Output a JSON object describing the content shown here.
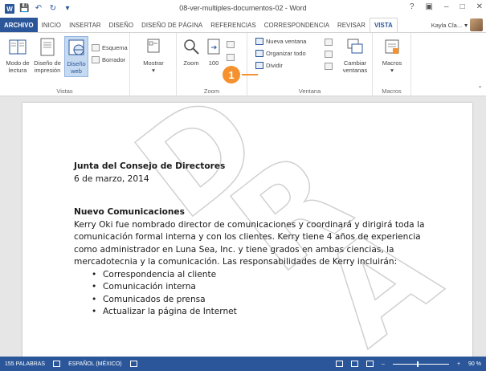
{
  "window": {
    "title": "08-ver-multiples-documentos-02 - Word",
    "controls": [
      "?",
      "▣",
      "–",
      "□",
      "✕"
    ]
  },
  "tabs": [
    {
      "label": "ARCHIVO",
      "kind": "file"
    },
    {
      "label": "INICIO"
    },
    {
      "label": "INSERTAR"
    },
    {
      "label": "DISEÑO"
    },
    {
      "label": "DISEÑO DE PÁGINA"
    },
    {
      "label": "REFERENCIAS"
    },
    {
      "label": "CORRESPONDENCIA"
    },
    {
      "label": "REVISAR"
    },
    {
      "label": "VISTA",
      "kind": "active"
    }
  ],
  "user": {
    "name": "Kayla Cla..."
  },
  "ribbon": {
    "vistas": {
      "label": "Vistas",
      "modo_lectura": "Modo de\nlectura",
      "diseno_impresion": "Diseño de\nimpresión",
      "diseno_web": "Diseño\nweb",
      "esquema": "Esquema",
      "borrador": "Borrador"
    },
    "mostrar": {
      "label": "Mostrar"
    },
    "zoom": {
      "label": "Zoom",
      "zoom_btn": "Zoom",
      "percent": "100"
    },
    "ventana": {
      "label": "Ventana",
      "nueva_ventana": "Nueva ventana",
      "organizar_todo": "Organizar todo",
      "dividir": "Dividir",
      "cambiar_ventanas": "Cambiar\nventanas"
    },
    "macros": {
      "label": "Macros",
      "macros_btn": "Macros"
    }
  },
  "callout": {
    "number": "1"
  },
  "document": {
    "heading1": "Junta del Consejo de Directores",
    "date": "6 de marzo, 2014",
    "heading2": "Nuevo Comunicaciones",
    "paragraph": "Kerry Oki fue nombrado director de comunicaciones y coordinará y dirigirá toda la comunicación formal interna y con los clientes. Kerry tiene 4 años de experiencia como administrador en Luna Sea, Inc. y tiene grados en ambas ciencias, la mercadotecnia y la comunicación. Las responsabilidades de Kerry incluirán:",
    "bullets": [
      "Correspondencia al cliente",
      "Comunicación interna",
      "Comunicados de prensa",
      "Actualizar la página de Internet"
    ]
  },
  "watermark": {
    "text": "DRAFT"
  },
  "status": {
    "words": "155 PALABRAS",
    "language": "ESPAÑOL (MÉXICO)",
    "zoom": "90 %",
    "zoom_level_pct": 90
  },
  "colors": {
    "accent": "#2b579a",
    "callout": "#f5922f"
  }
}
